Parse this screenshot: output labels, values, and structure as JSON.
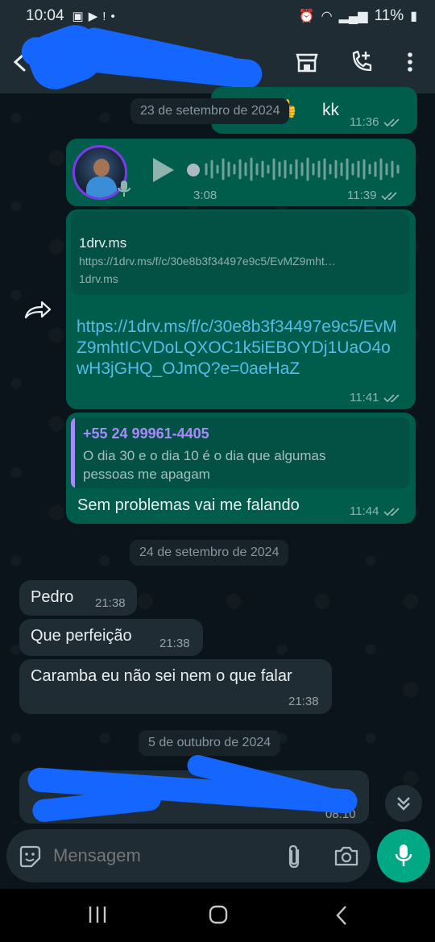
{
  "status_bar": {
    "time": "10:04",
    "battery": "11%"
  },
  "header": {
    "contact_name": ""
  },
  "chat": {
    "date_chips": [
      "23 de setembro de 2024",
      "24 de setembro de 2024",
      "5 de outubro de 2024"
    ],
    "msg_kk": {
      "text": "kk",
      "time": "11:36"
    },
    "audio": {
      "duration": "3:08",
      "time": "11:39"
    },
    "link_msg": {
      "preview_title": "1drv.ms",
      "preview_url": "https://1drv.ms/f/c/30e8b3f34497e9c5/EvMZ9mht…",
      "preview_domain": "1drv.ms",
      "link_text": "https://1drv.ms/f/c/30e8b3f34497e9c5/EvMZ9mhtICVDoLQXOC1k5iEBOYDj1UaO4owH3jGHQ_OJmQ?e=0aeHaZ",
      "time": "11:41"
    },
    "reply_msg": {
      "quote_author": "+55 24 99961-4405",
      "quote_line1": "O dia 30 e o dia 10 é o dia que algumas",
      "quote_line2": "pessoas me apagam",
      "text": "Sem problemas vai me falando",
      "time": "11:44"
    },
    "incoming": [
      {
        "text": "Pedro",
        "time": "21:38"
      },
      {
        "text": "Que perfeição",
        "time": "21:38"
      },
      {
        "text": "Caramba eu não sei nem o que falar",
        "time": "21:38"
      }
    ],
    "last_msg_time": "08:10"
  },
  "input": {
    "placeholder": "Mensagem"
  },
  "colors": {
    "outgoing": "#005c4b",
    "incoming": "#1f2c34",
    "accent": "#00a884",
    "link": "#53bdeb",
    "background": "#0b141a"
  }
}
